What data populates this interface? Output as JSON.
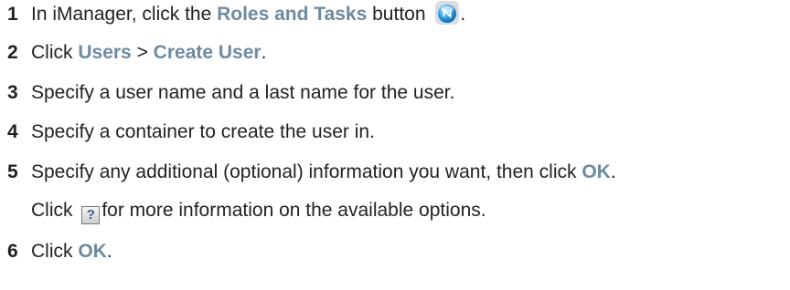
{
  "steps": [
    {
      "number": "1",
      "parts": [
        "In iManager, click the ",
        "Roles and Tasks",
        " button ",
        "."
      ]
    },
    {
      "number": "2",
      "parts": [
        "Click ",
        "Users",
        " > ",
        "Create User",
        "."
      ]
    },
    {
      "number": "3",
      "parts": [
        "Specify a user name and a last name for the user."
      ]
    },
    {
      "number": "4",
      "parts": [
        "Specify a container to create the user in."
      ]
    },
    {
      "number": "5",
      "parts": [
        "Specify any additional (optional) information you want, then click ",
        "OK",
        "."
      ]
    },
    {
      "parts": [
        "Click ",
        "for more information on the available options."
      ]
    },
    {
      "number": "6",
      "parts": [
        "Click ",
        "OK",
        "."
      ]
    }
  ],
  "icons": {
    "roles_and_tasks": "roles-and-tasks-icon",
    "help": "help-icon",
    "help_glyph": "?"
  },
  "colors": {
    "ui_label": "#6d8aa0",
    "text": "#222222"
  }
}
